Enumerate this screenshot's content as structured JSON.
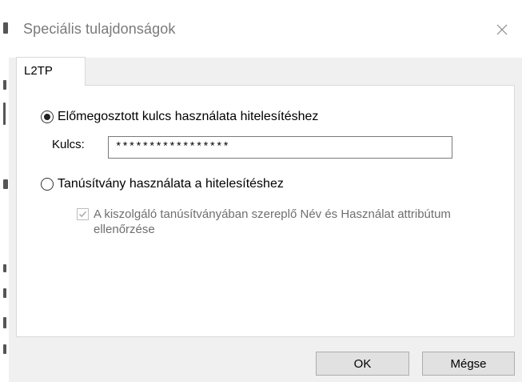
{
  "dialog": {
    "title": "Speciális tulajdonságok",
    "close_icon": "close-icon"
  },
  "tabs": [
    {
      "label": "L2TP",
      "selected": true
    }
  ],
  "auth": {
    "psk_label": "Előmegosztott kulcs használata hitelesítéshez",
    "psk_selected": true,
    "key_label": "Kulcs:",
    "key_value": "*****************",
    "cert_label": "Tanúsítvány használata a hitelesítéshez",
    "cert_selected": false,
    "verify_label": "A kiszolgáló tanúsítványában szereplő Név és Használat attribútum ellenőrzése",
    "verify_checked": true,
    "verify_disabled": true
  },
  "buttons": {
    "ok": "OK",
    "cancel": "Mégse"
  }
}
